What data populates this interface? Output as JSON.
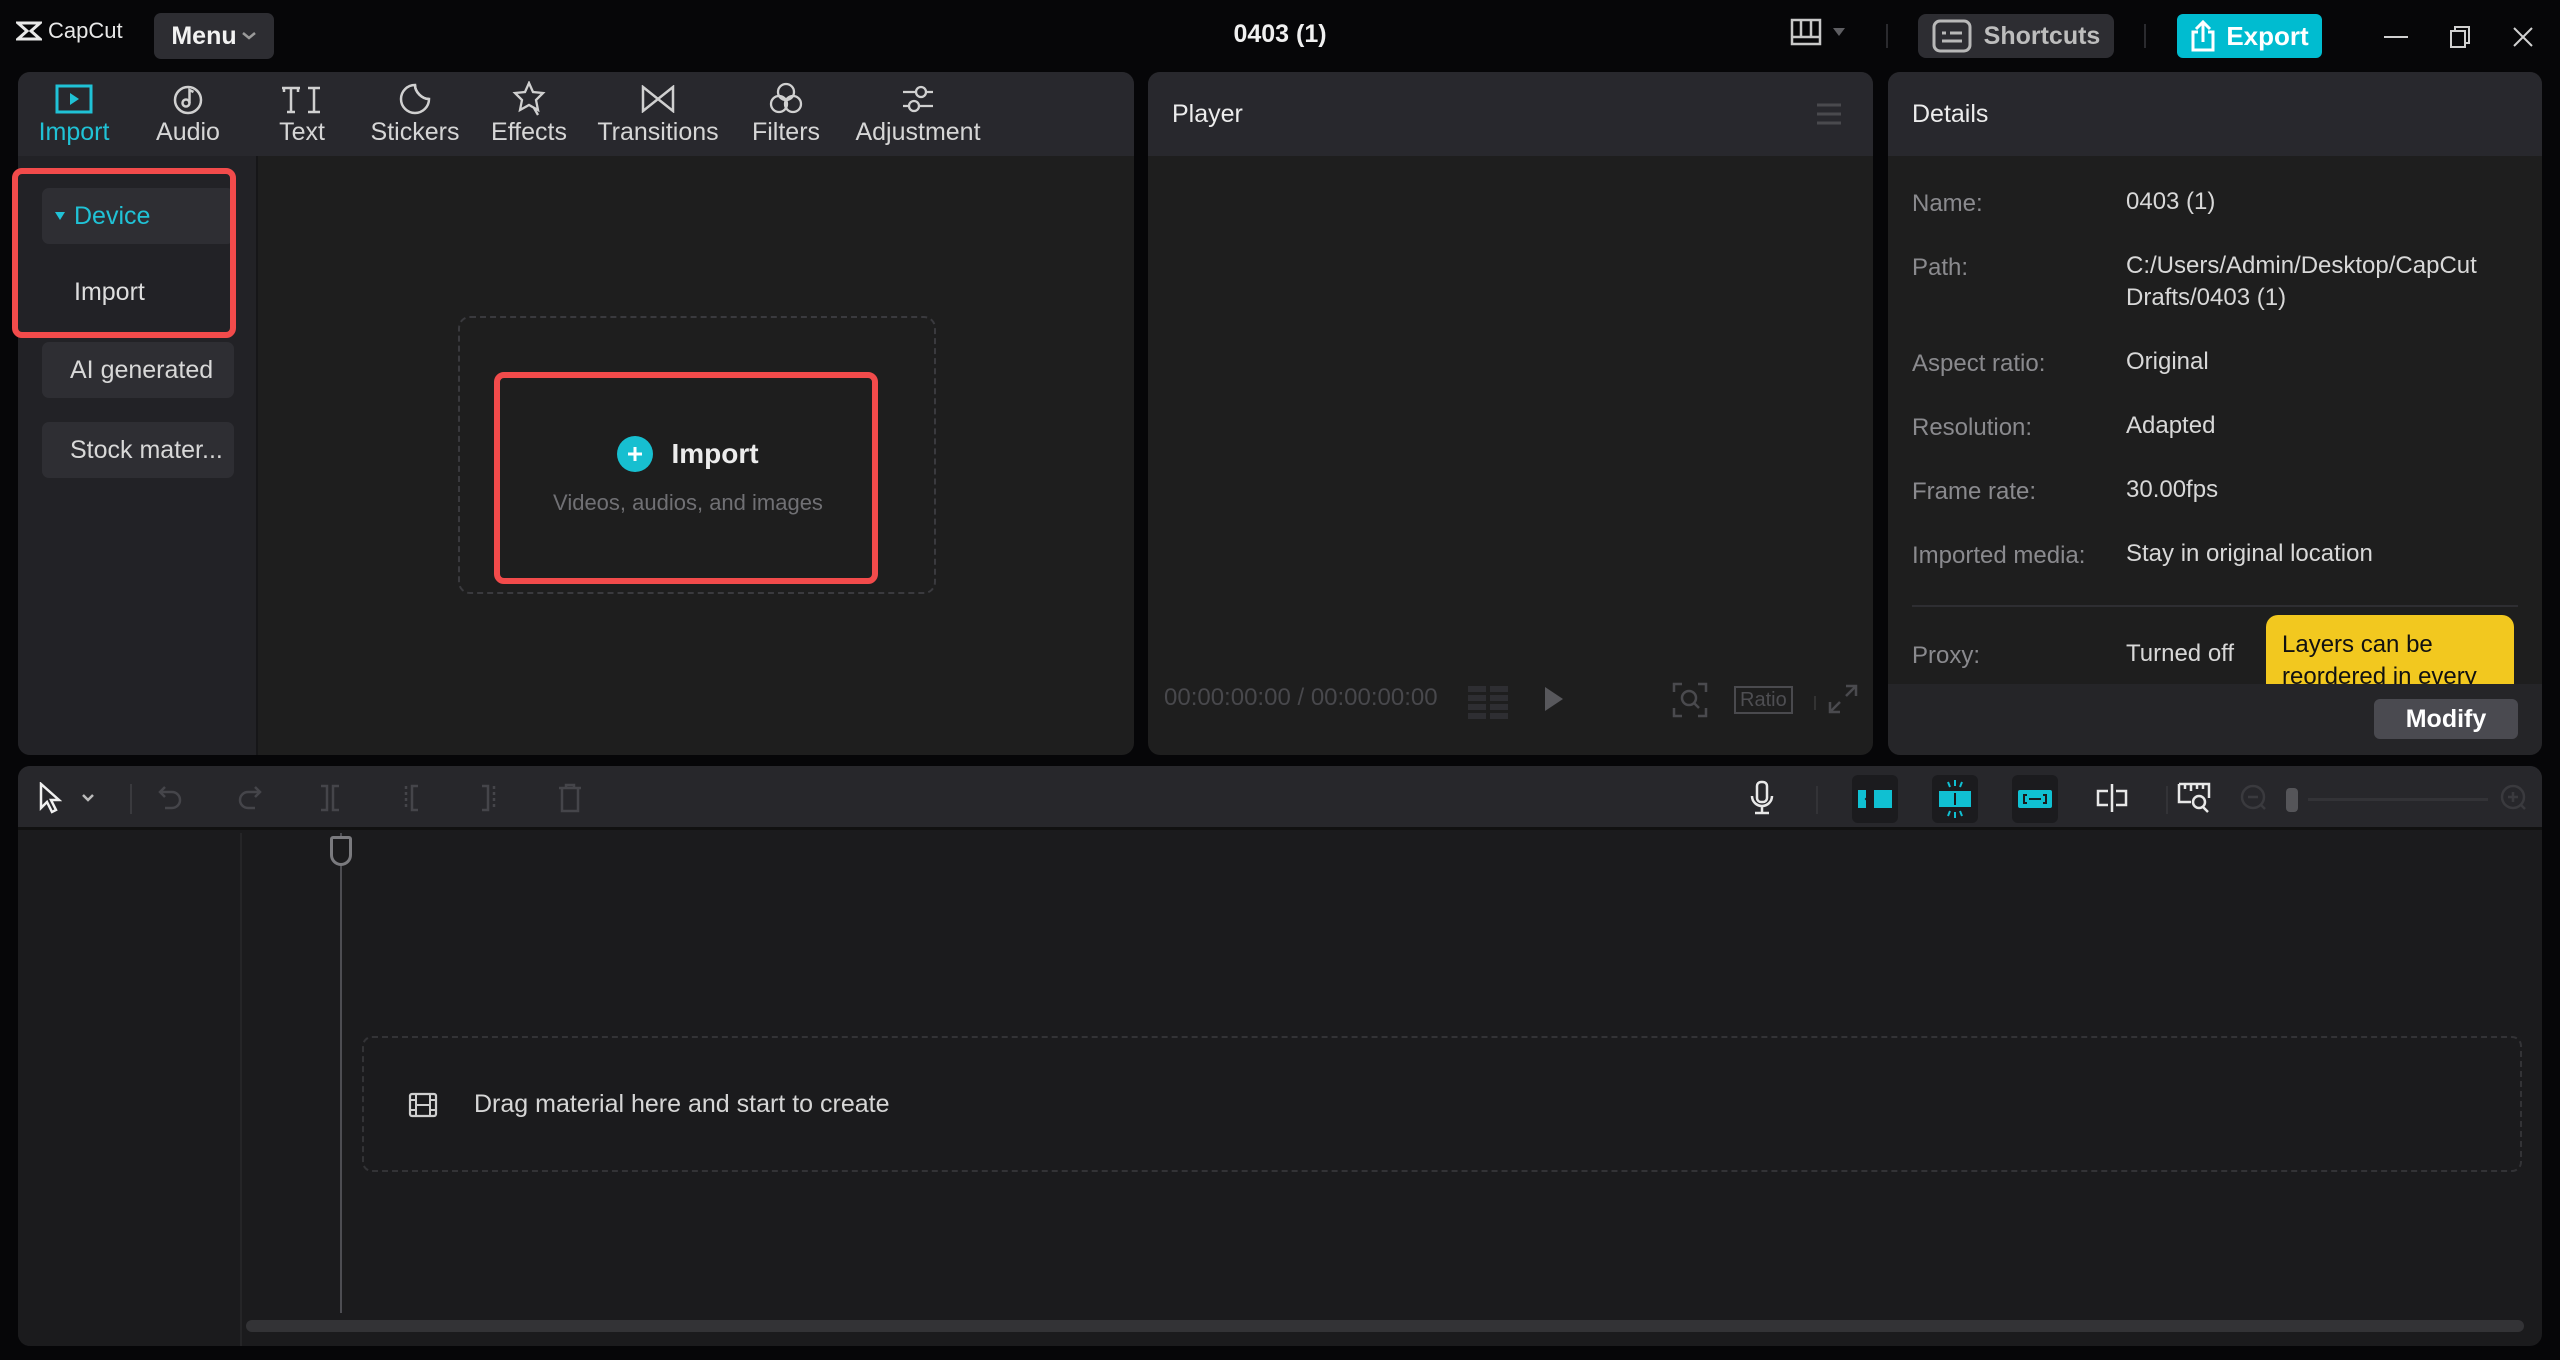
{
  "app": {
    "logo_text": "CapCut",
    "menu_label": "Menu",
    "window_title": "0403 (1)",
    "shortcuts_label": "Shortcuts",
    "export_label": "Export",
    "accent_color": "#00bcd0"
  },
  "media": {
    "tabs": [
      {
        "label": "Import",
        "icon": "import-icon",
        "active": true
      },
      {
        "label": "Audio",
        "icon": "audio-icon"
      },
      {
        "label": "Text",
        "icon": "text-icon"
      },
      {
        "label": "Stickers",
        "icon": "stickers-icon"
      },
      {
        "label": "Effects",
        "icon": "effects-icon"
      },
      {
        "label": "Transitions",
        "icon": "transitions-icon"
      },
      {
        "label": "Filters",
        "icon": "filters-icon"
      },
      {
        "label": "Adjustment",
        "icon": "adjustment-icon"
      }
    ],
    "sidebar": {
      "device_label": "Device",
      "import_label": "Import",
      "ai_generated_label": "AI generated",
      "stock_label": "Stock mater..."
    },
    "import_area": {
      "title": "Import",
      "subtitle": "Videos, audios, and images"
    }
  },
  "player": {
    "title": "Player",
    "current_time": "00:00:00:00",
    "total_time": "00:00:00:00",
    "time_separator": "/",
    "ratio_label": "Ratio"
  },
  "details": {
    "title": "Details",
    "rows": [
      {
        "label": "Name:",
        "value": "0403 (1)"
      },
      {
        "label": "Path:",
        "value": "C:/Users/Admin/Desktop/CapCut Drafts/0403 (1)"
      },
      {
        "label": "Aspect ratio:",
        "value": "Original"
      },
      {
        "label": "Resolution:",
        "value": "Adapted"
      },
      {
        "label": "Frame rate:",
        "value": "30.00fps"
      },
      {
        "label": "Imported media:",
        "value": "Stay in original location"
      },
      {
        "label": "Proxy:",
        "value": "Turned off"
      }
    ],
    "tooltip": "Layers can be reordered in every",
    "modify_label": "Modify"
  },
  "timeline": {
    "drop_hint": "Drag material here and start to create",
    "zoom_level": 0
  }
}
